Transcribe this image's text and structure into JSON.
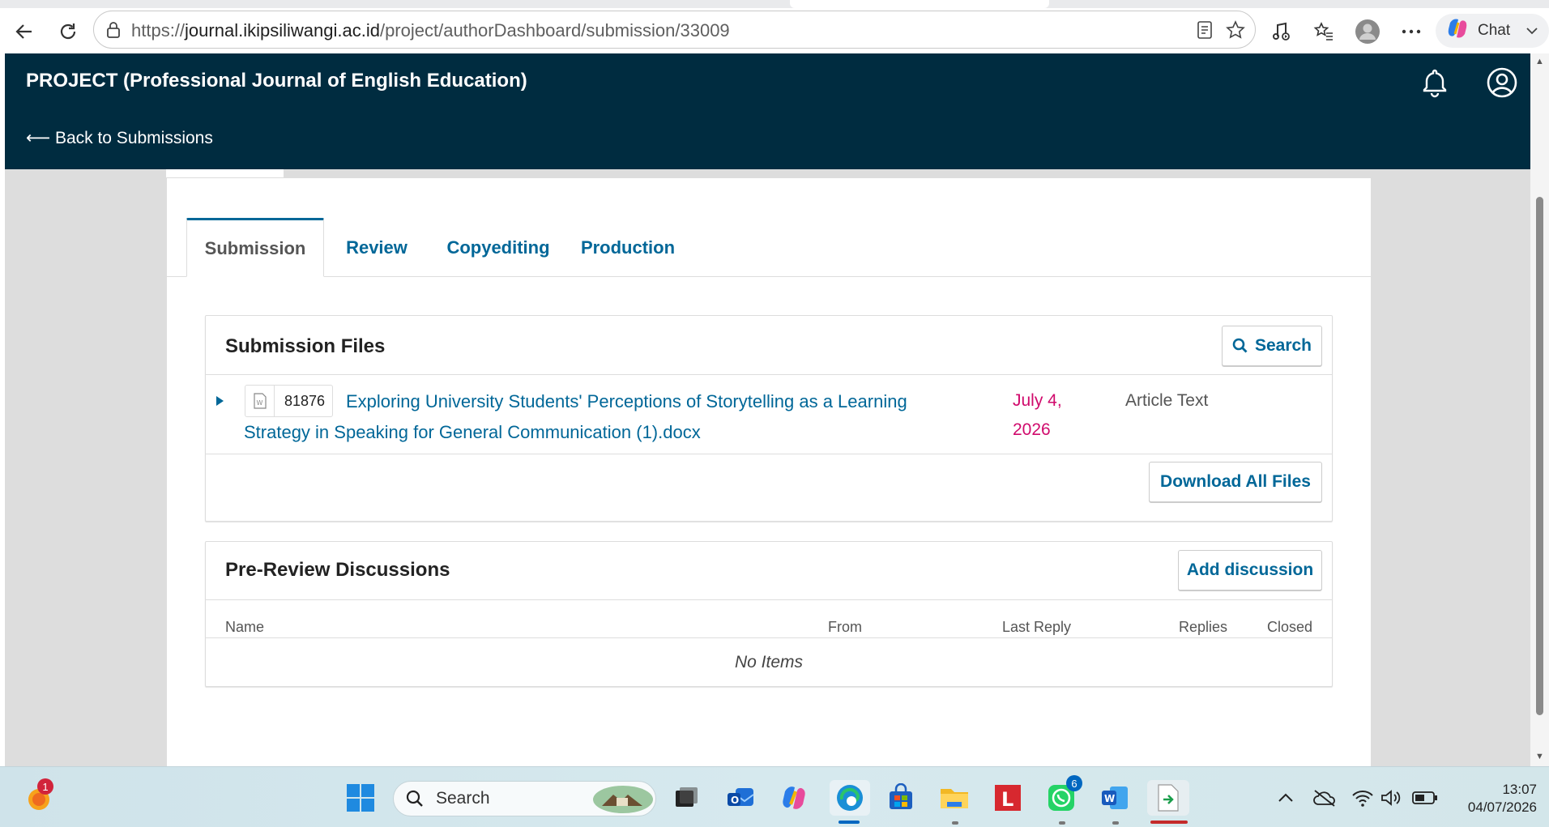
{
  "browser": {
    "url_prefix": "https://",
    "url_host": "journal.ikipsiliwangi.ac.id",
    "url_path": "/project/authorDashboard/submission/33009",
    "chat_label": "Chat"
  },
  "header": {
    "title": "PROJECT (Professional Journal of English Education)",
    "back_link": "⟵ Back to Submissions"
  },
  "tabs": [
    {
      "label": "Submission",
      "active": true
    },
    {
      "label": "Review"
    },
    {
      "label": "Copyediting"
    },
    {
      "label": "Production"
    }
  ],
  "submission_files": {
    "title": "Submission Files",
    "search_label": "Search",
    "files": [
      {
        "id": "81876",
        "name": "Exploring University Students' Perceptions of Storytelling as a Learning Strategy in Speaking for General Communication (1).docx",
        "date": "July 4, 2026",
        "type": "Article Text"
      }
    ],
    "download_all_label": "Download All Files"
  },
  "discussions": {
    "title": "Pre-Review Discussions",
    "add_label": "Add discussion",
    "columns": [
      "Name",
      "From",
      "Last Reply",
      "Replies",
      "Closed"
    ],
    "empty_text": "No Items"
  },
  "taskbar": {
    "search_placeholder": "Search",
    "notification_badge": "1",
    "whatsapp_badge": "6",
    "time": "13:07",
    "date": "04/07/2026"
  },
  "colors": {
    "header_bg": "#002c40",
    "link": "#006798",
    "date": "#d00a6c"
  }
}
